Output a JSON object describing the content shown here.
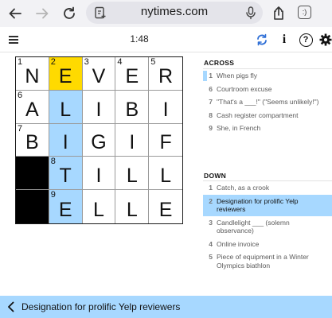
{
  "browser": {
    "url": "nytimes.com",
    "tab_count": ":)"
  },
  "toolbar": {
    "timer": "1:48",
    "info_label": "i",
    "help_label": "?"
  },
  "board": {
    "rows": [
      [
        {
          "num": "1",
          "letter": "N"
        },
        {
          "num": "2",
          "letter": "E",
          "state": "selected"
        },
        {
          "num": "3",
          "letter": "V"
        },
        {
          "num": "4",
          "letter": "E"
        },
        {
          "num": "5",
          "letter": "R"
        }
      ],
      [
        {
          "num": "6",
          "letter": "A"
        },
        {
          "num": "",
          "letter": "L",
          "state": "word"
        },
        {
          "num": "",
          "letter": "I"
        },
        {
          "num": "",
          "letter": "B"
        },
        {
          "num": "",
          "letter": "I"
        }
      ],
      [
        {
          "num": "7",
          "letter": "B"
        },
        {
          "num": "",
          "letter": "I",
          "state": "word"
        },
        {
          "num": "",
          "letter": "G"
        },
        {
          "num": "",
          "letter": "I"
        },
        {
          "num": "",
          "letter": "F"
        }
      ],
      [
        {
          "block": true
        },
        {
          "num": "8",
          "letter": "T",
          "state": "word"
        },
        {
          "num": "",
          "letter": "I"
        },
        {
          "num": "",
          "letter": "L"
        },
        {
          "num": "",
          "letter": "L"
        }
      ],
      [
        {
          "block": true
        },
        {
          "num": "9",
          "letter": "E",
          "state": "word"
        },
        {
          "num": "",
          "letter": "L"
        },
        {
          "num": "",
          "letter": "L"
        },
        {
          "num": "",
          "letter": "E"
        }
      ]
    ]
  },
  "across": {
    "heading": "ACROSS",
    "clues": [
      {
        "num": "1",
        "text": "When pigs fly",
        "state": "cross"
      },
      {
        "num": "6",
        "text": "Courtroom excuse"
      },
      {
        "num": "7",
        "text": "\"That's a ___!\" (\"Seems unlikely!\")"
      },
      {
        "num": "8",
        "text": "Cash register compartment"
      },
      {
        "num": "9",
        "text": "She, in French"
      }
    ]
  },
  "down": {
    "heading": "DOWN",
    "clues": [
      {
        "num": "1",
        "text": "Catch, as a crook"
      },
      {
        "num": "2",
        "text": "Designation for prolific Yelp reviewers",
        "state": "current"
      },
      {
        "num": "3",
        "text": "Candlelight ___ (solemn observance)"
      },
      {
        "num": "4",
        "text": "Online invoice"
      },
      {
        "num": "5",
        "text": "Piece of equipment in a Winter Olympics biathlon"
      }
    ]
  },
  "clue_bar": {
    "text": "Designation for prolific Yelp reviewers"
  },
  "colors": {
    "selected_cell": "#ffda00",
    "word_highlight": "#a7d8ff",
    "block": "#000000",
    "rebus_icon": "#2f6fd6"
  }
}
